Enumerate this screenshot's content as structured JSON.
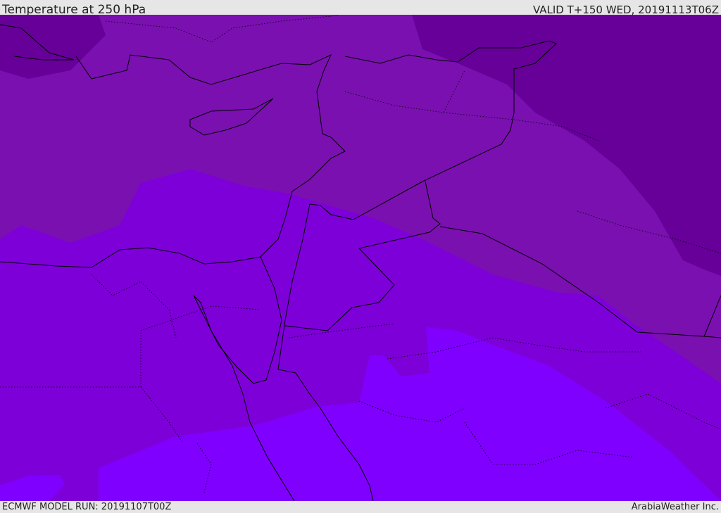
{
  "header": {
    "title": "Temperature at 250 hPa",
    "valid": "VALID T+150 WED, 20191113T06Z"
  },
  "footer": {
    "model_run": "ECMWF MODEL RUN: 20191107T00Z",
    "credit": "ArabiaWeather Inc."
  },
  "colors": {
    "band_coldest": "#660099",
    "band_cold": "#7a10b0",
    "band_mid": "#7d00d8",
    "band_warm": "#8000ff",
    "coastline": "#000000"
  }
}
